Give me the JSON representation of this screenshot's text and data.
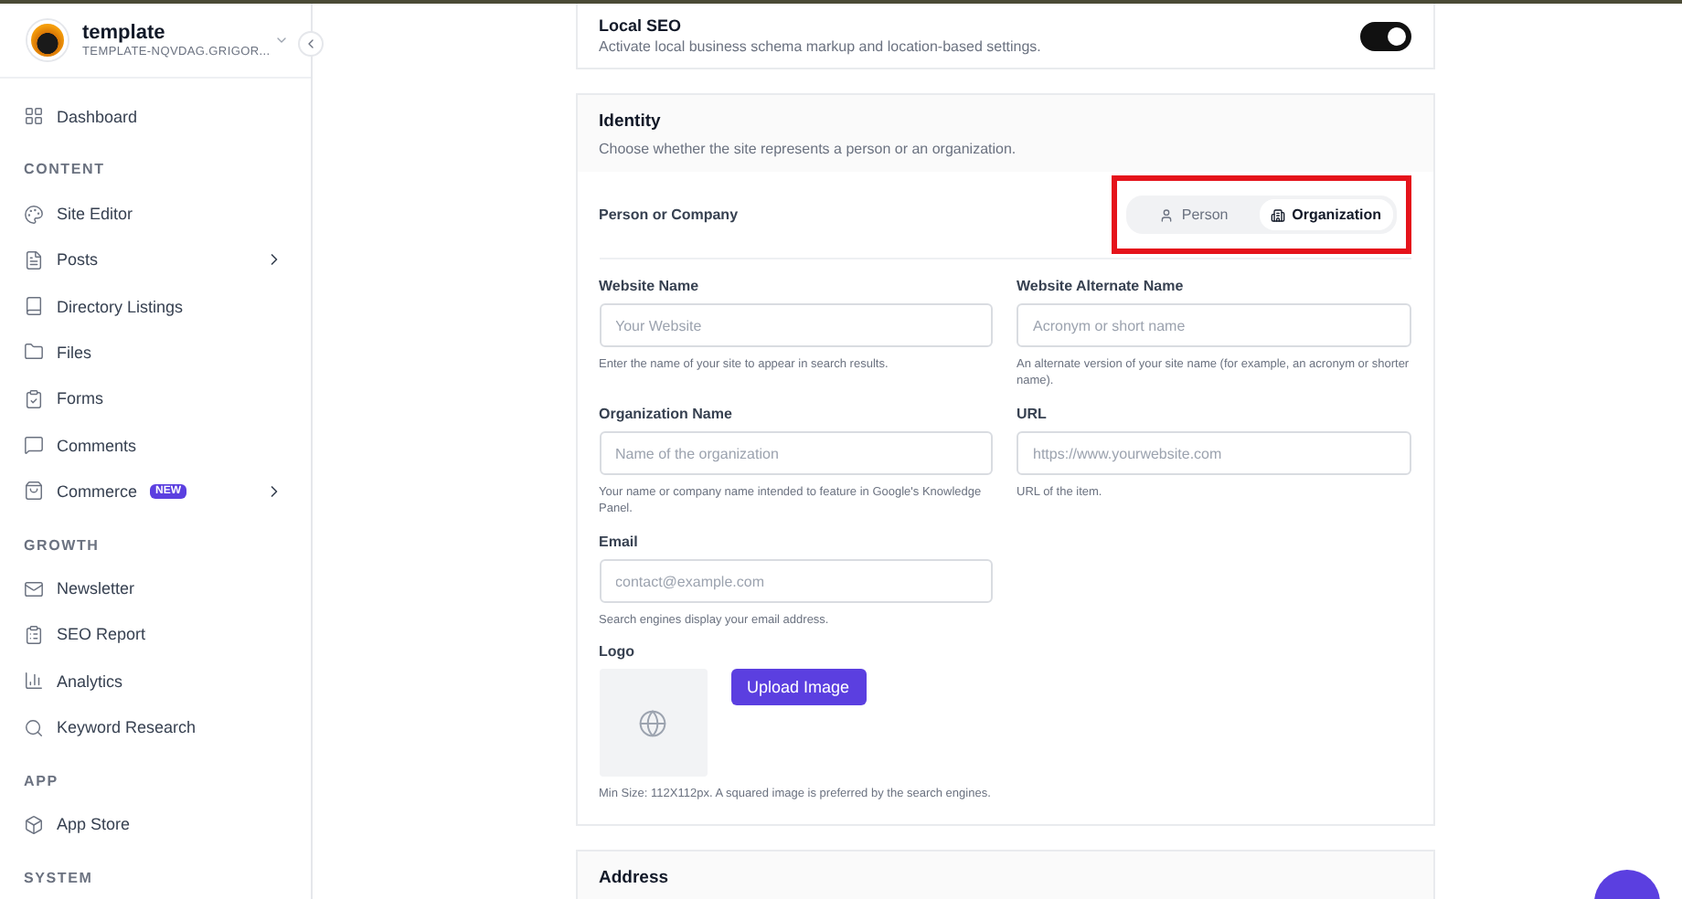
{
  "sidebar": {
    "site": {
      "name": "template",
      "domain": "TEMPLATE-NQVDAG.GRIGOR..."
    },
    "sections": [
      {
        "items": [
          {
            "label": "Dashboard",
            "has_submenu": false
          }
        ]
      },
      {
        "heading": "CONTENT",
        "items": [
          {
            "label": "Site Editor",
            "has_submenu": false
          },
          {
            "label": "Posts",
            "has_submenu": true
          },
          {
            "label": "Directory Listings",
            "has_submenu": false
          },
          {
            "label": "Files",
            "has_submenu": false
          },
          {
            "label": "Forms",
            "has_submenu": false
          },
          {
            "label": "Comments",
            "has_submenu": false
          },
          {
            "label": "Commerce",
            "badge": "NEW",
            "has_submenu": true
          }
        ]
      },
      {
        "heading": "GROWTH",
        "items": [
          {
            "label": "Newsletter",
            "has_submenu": false
          },
          {
            "label": "SEO Report",
            "has_submenu": false
          },
          {
            "label": "Analytics",
            "has_submenu": false
          },
          {
            "label": "Keyword Research",
            "has_submenu": false
          }
        ]
      },
      {
        "heading": "APP",
        "items": [
          {
            "label": "App Store",
            "has_submenu": false
          }
        ]
      },
      {
        "heading": "SYSTEM"
      }
    ]
  },
  "local_seo": {
    "title": "Local SEO",
    "description": "Activate local business schema markup and location-based settings.",
    "on": true
  },
  "identity": {
    "title": "Identity",
    "description": "Choose whether the site represents a person or an organization.",
    "type_field": {
      "label": "Person or Company",
      "options": [
        {
          "label": "Person",
          "selected": false
        },
        {
          "label": "Organization",
          "selected": true
        }
      ]
    },
    "fields": [
      {
        "label": "Website Name",
        "placeholder": "Your Website",
        "help": "Enter the name of your site to appear in search results."
      },
      {
        "label": "Website Alternate Name",
        "placeholder": "Acronym or short name",
        "help": "An alternate version of your site name (for example, an acronym or shorter name)."
      },
      {
        "label": "Organization Name",
        "placeholder": "Name of the organization",
        "help": "Your name or company name intended to feature in Google's Knowledge Panel."
      },
      {
        "label": "URL",
        "placeholder": "https://www.yourwebsite.com",
        "help": "URL of the item."
      },
      {
        "label": "Email",
        "placeholder": "contact@example.com",
        "help": "Search engines display your email address."
      }
    ],
    "logo": {
      "label": "Logo",
      "button": "Upload Image",
      "help": "Min Size: 112X112px. A squared image is preferred by the search engines."
    }
  },
  "address": {
    "title": "Address"
  }
}
